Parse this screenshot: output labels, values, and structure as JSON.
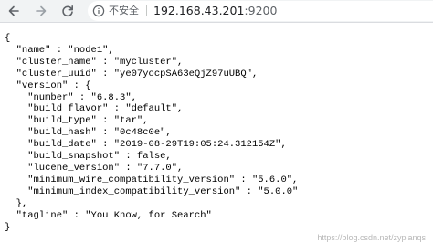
{
  "browser": {
    "icons": {
      "back": "arrow-left-icon",
      "forward": "arrow-right-icon",
      "reload": "reload-icon",
      "info": "info-circle-icon"
    },
    "security_label": "不安全",
    "url_host": "192.168.43.201",
    "url_port": ":9200"
  },
  "json_lines": [
    "{",
    "  \"name\" : \"node1\",",
    "  \"cluster_name\" : \"mycluster\",",
    "  \"cluster_uuid\" : \"ye07yocpSA63eQjZ97uUBQ\",",
    "  \"version\" : {",
    "    \"number\" : \"6.8.3\",",
    "    \"build_flavor\" : \"default\",",
    "    \"build_type\" : \"tar\",",
    "    \"build_hash\" : \"0c48c0e\",",
    "    \"build_date\" : \"2019-08-29T19:05:24.312154Z\",",
    "    \"build_snapshot\" : false,",
    "    \"lucene_version\" : \"7.7.0\",",
    "    \"minimum_wire_compatibility_version\" : \"5.6.0\",",
    "    \"minimum_index_compatibility_version\" : \"5.0.0\"",
    "  },",
    "  \"tagline\" : \"You Know, for Search\"",
    "}"
  ],
  "watermark": "https://blog.csdn.net/zypianqs"
}
